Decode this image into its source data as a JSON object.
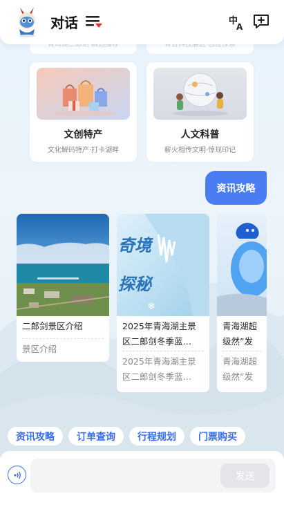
{
  "header": {
    "title": "对话"
  },
  "stubs": [
    {
      "text": "青海湖二郎剑·精选推荐"
    },
    {
      "text": "青台科技展区·感应探索"
    }
  ],
  "features": [
    {
      "title": "文创特产",
      "subtitle": "文化解码特产·打卡湖畔"
    },
    {
      "title": "人文科普",
      "subtitle": "薪火相传文明·惊现印记"
    }
  ],
  "user_message": "资讯攻略",
  "news": [
    {
      "title": "二郎剑景区介绍",
      "summary": "景区介绍"
    },
    {
      "title": "2025年青海湖主景区二郎剑冬季蓝…",
      "summary": "2025年青海湖主景区二郎剑冬季蓝…",
      "image_text_1": "奇境",
      "image_text_2": "探秘"
    },
    {
      "title": "青海湖超级然”发布!",
      "summary": "青海湖超级然”发布!"
    }
  ],
  "chips": [
    "资讯攻略",
    "订单查询",
    "行程规划",
    "门票购买"
  ],
  "input": {
    "placeholder": "",
    "send_label": "发送"
  },
  "colors": {
    "accent": "#4a7cf2",
    "chip_text": "#3a6ee8",
    "send_disabled": "#e3e5ea"
  }
}
